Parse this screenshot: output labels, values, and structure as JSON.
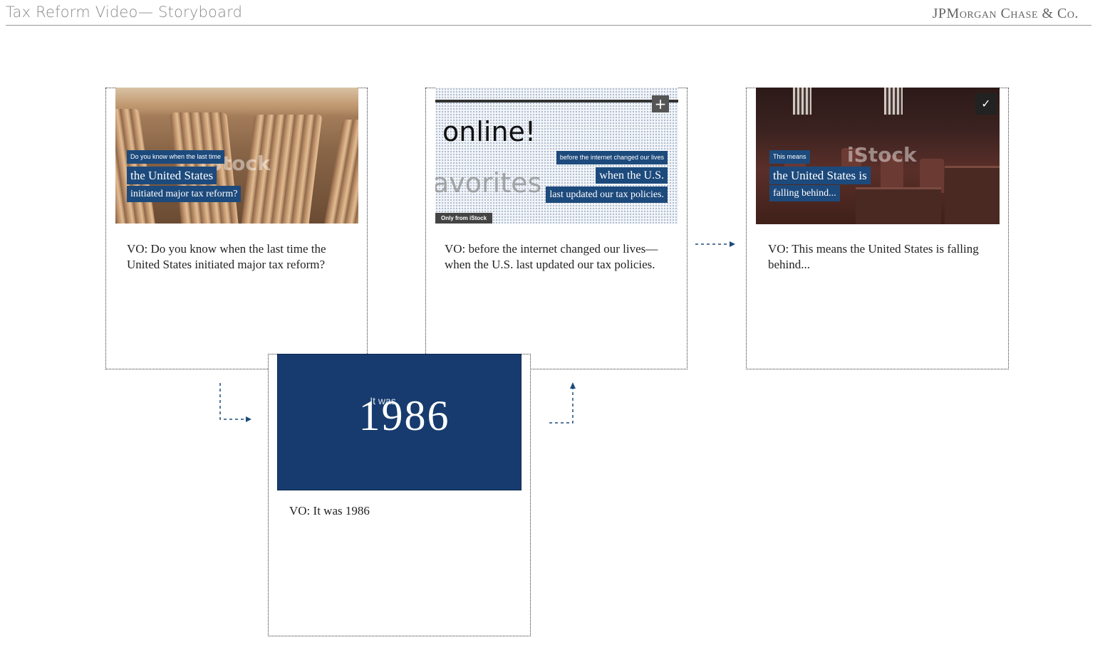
{
  "header": {
    "title": "Tax Reform Video— Storyboard",
    "brand": "JPMorgan Chase & Co."
  },
  "colors": {
    "caption_bg": "#1d4a7c",
    "slate_bg": "#173b6e",
    "arrow": "#1d4a7c"
  },
  "frames": [
    {
      "captions": [
        "Do you know when the last time",
        "the United States",
        "initiated major tax reform?"
      ],
      "watermark": "iStock",
      "vo": "VO: Do you know when the last time the United States initiated major tax reform?"
    },
    {
      "screen_word": "online!",
      "screen_word_faded": "avorites",
      "captions": [
        "before the internet changed our lives",
        "when the U.S.",
        "last updated our tax policies."
      ],
      "tag": "Only from iStock",
      "plus_icon": "plus-icon",
      "vo": "VO: before the internet changed our lives—when the U.S. last updated our tax policies."
    },
    {
      "captions": [
        "This means",
        "the United States is",
        "falling behind..."
      ],
      "watermark": "iStock",
      "check_icon": "check-icon",
      "vo": "VO: This means the United States is falling behind..."
    },
    {
      "lead": "It was",
      "year": "1986",
      "vo": "VO: It was 1986"
    }
  ]
}
